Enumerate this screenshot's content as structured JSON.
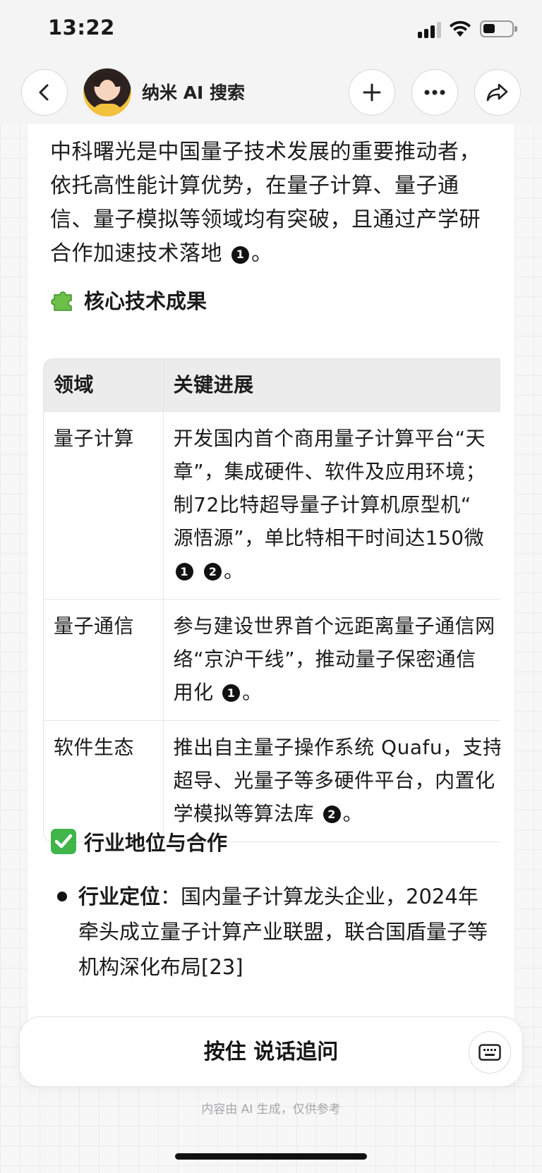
{
  "status_bar": {
    "time": "13:22"
  },
  "nav": {
    "title": "纳米 AI 搜索",
    "back_icon": "chevron-left-icon",
    "plus_icon": "plus-icon",
    "more_icon": "more-icon",
    "share_icon": "share-icon"
  },
  "content": {
    "intro_text": "中科曙光是中国量子技术发展的重要推动者，依托高性能计算优势，在量子计算、量子通信、量子模拟等领域均有突破，且通过产学研合作加速技术落地",
    "intro_refs": [
      "1"
    ],
    "intro_end": "。",
    "section1_title": "核心技术成果",
    "table": {
      "headers": [
        "领域",
        "关键进展"
      ],
      "rows": [
        {
          "field": "量子计算",
          "lines": [
            "开发国内首个商用量子计算平台“天",
            "章”，集成硬件、软件及应用环境；",
            "制72比特超导量子计算机原型机“",
            "源悟源”，单比特相干时间达150微"
          ],
          "refs": [
            "1",
            "2"
          ],
          "end": "。"
        },
        {
          "field": "量子通信",
          "lines": [
            "参与建设世界首个远距离量子通信网",
            "络“京沪干线”，推动量子保密通信",
            "用化"
          ],
          "refs": [
            "1"
          ],
          "end": "。"
        },
        {
          "field": "软件生态",
          "lines": [
            "推出自主量子操作系统 Quafu，支持",
            "超导、光量子等多硬件平台，内置化",
            "学模拟等算法库"
          ],
          "refs": [
            "2"
          ],
          "end": "。"
        }
      ]
    },
    "section2_title": "行业地位与合作",
    "bullet": {
      "label": "行业定位",
      "text": "：国内量子计算龙头企业，2024年牵头成立量子计算产业联盟，联合国盾量子等机构深化布局[23]"
    }
  },
  "input_bar": {
    "label": "按住 说话追问",
    "keyboard_icon": "keyboard-icon"
  },
  "footer_note": "内容由 AI 生成，仅供参考"
}
